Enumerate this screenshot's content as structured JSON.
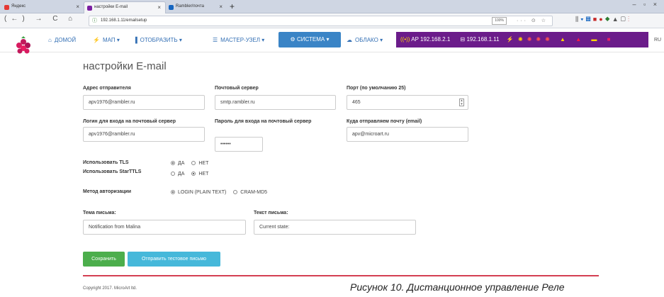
{
  "browser": {
    "tabs": [
      {
        "label": "Яндекс",
        "close": "×",
        "color": "#e53935"
      },
      {
        "label": "настройки E-mail",
        "close": "×",
        "color": "#7b1fa2"
      },
      {
        "label": "Rambler/почта",
        "close": "×",
        "color": "#1565c0"
      }
    ],
    "new_tab": "+",
    "window_controls": "– ▫ ×",
    "nav_buttons": "(←) → C ⌂",
    "url": "192.168.1.11/emailsetup",
    "zoom": "100%",
    "url_actions": "··· ⊙ ☆",
    "lang": "RU"
  },
  "navbar": {
    "home_icon": "home-icon",
    "home": "ДОМОЙ",
    "map": "МАП ▾",
    "display": "ОТОБРАЗИТЬ ▾",
    "master": "МАСТЕР-УЗЕЛ ▾",
    "system": "СИСТЕМА ▾",
    "cloud": "ОБЛАКО ▾",
    "status_ap": "AP 192.168.2.1",
    "status_ip": "192.168.1.11",
    "colors": {
      "system_bg": "#3a84c6",
      "status_bg": "#6b1c8a",
      "link": "#3470b5"
    }
  },
  "page": {
    "title": "настройки E-mail"
  },
  "form": {
    "sender_label": "Адрес отправителя",
    "sender_value": "apv1976@rambler.ru",
    "server_label": "Почтовый сервер",
    "server_value": "smtp.rambler.ru",
    "port_label": "Порт (по умолчанию 25)",
    "port_value": "465",
    "login_label": "Логин для входа на почтовый сервер",
    "login_value": "apv1976@rambler.ru",
    "password_label": "Пароль для входа на почтовый сервер",
    "password_value": "••••••",
    "to_label": "Куда отправляем почту (email)",
    "to_value": "apv@microart.ru",
    "tls_label": "Использовать TLS",
    "tls_yes": "ДА",
    "tls_no": "НЕТ",
    "tls_selected": "yes",
    "starttls_label": "Использовать StarTTLS",
    "starttls_yes": "ДА",
    "starttls_no": "НЕТ",
    "starttls_selected": "no",
    "auth_label": "Метод авторизации",
    "auth_login": "LOGIN (PLAIN TEXT)",
    "auth_cram": "CRAM-MD5",
    "auth_selected": "login",
    "subject_label": "Тема письма:",
    "subject_value": "Notification from Malina",
    "body_label": "Текст письма:",
    "body_value": "Current state:",
    "save_button": "Сохранить",
    "test_button": "Отправить тестовое письмо"
  },
  "footer": {
    "copyright": "Copyright 2017. MicroArt ltd.",
    "caption": "Рисунок 10. Дистанционное управление Реле"
  },
  "colors": {
    "save": "#4cae4c",
    "test": "#46b8da",
    "divider": "#d43f52"
  }
}
